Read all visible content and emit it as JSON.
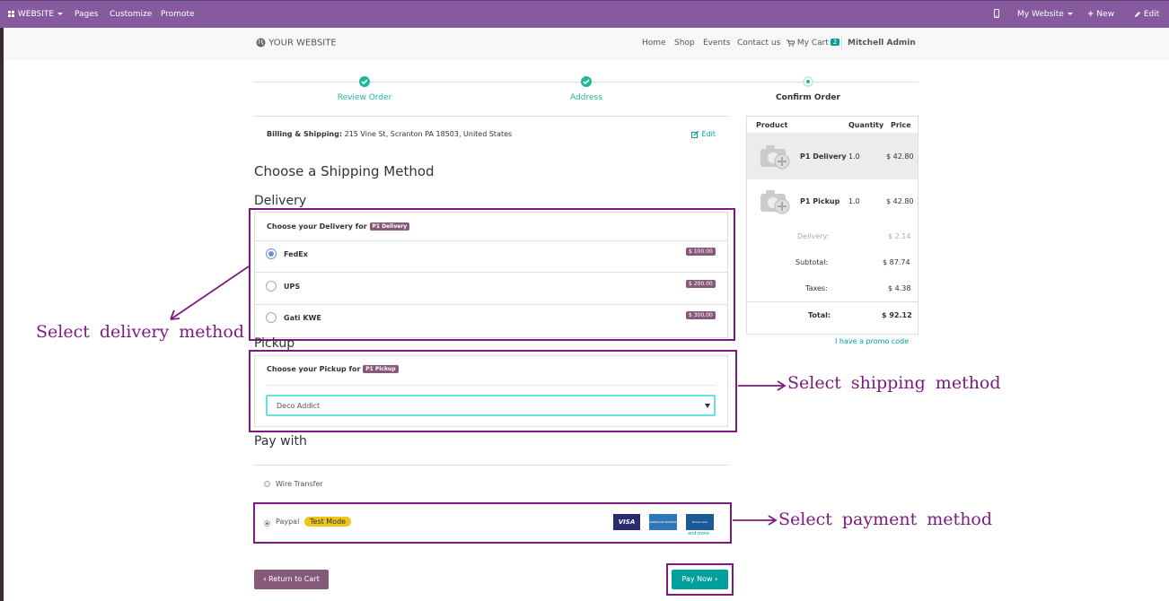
{
  "adminbar": {
    "website": "WEBSITE",
    "pages": "Pages",
    "customize": "Customize",
    "promote": "Promote",
    "my_website": "My Website",
    "new": "New",
    "edit": "Edit"
  },
  "navbar": {
    "logo": "YOUR WEBSITE",
    "links": [
      "Home",
      "Shop",
      "Events",
      "Contact us"
    ],
    "cart_label": "My Cart",
    "cart_count": "2",
    "user": "Mitchell Admin"
  },
  "wizard": {
    "steps": [
      {
        "label": "Review Order",
        "state": "done"
      },
      {
        "label": "Address",
        "state": "done"
      },
      {
        "label": "Confirm Order",
        "state": "current"
      }
    ]
  },
  "billing": {
    "label": "Billing & Shipping:",
    "address": "215 Vine St, Scranton PA 18503, United States",
    "edit": "Edit"
  },
  "shipping": {
    "title": "Choose a Shipping Method",
    "delivery_heading": "Delivery",
    "delivery_prompt": "Choose your Delivery for",
    "delivery_product": "P1 Delivery",
    "options": [
      {
        "name": "FedEx",
        "price": "$ 100.00",
        "selected": true
      },
      {
        "name": "UPS",
        "price": "$ 200.00",
        "selected": false
      },
      {
        "name": "Gati KWE",
        "price": "$ 300.00",
        "selected": false
      }
    ],
    "pickup_heading": "Pickup",
    "pickup_prompt": "Choose your Pickup for",
    "pickup_product": "P1 Pickup",
    "pickup_value": "Deco Addict"
  },
  "payment": {
    "title": "Pay with",
    "wire": "Wire Transfer",
    "paypal": "Paypal",
    "test_mode": "Test Mode",
    "cards": [
      "VISA",
      "AMERICAN EXPRESS",
      "Diners Club"
    ],
    "and_more": "and more"
  },
  "buttons": {
    "return": "Return to Cart",
    "pay": "Pay Now"
  },
  "cart": {
    "headers": [
      "Product",
      "Quantity",
      "Price"
    ],
    "rows": [
      {
        "name": "P1 Delivery",
        "qty": "1.0",
        "price": "$ 42.80"
      },
      {
        "name": "P1 Pickup",
        "qty": "1.0",
        "price": "$ 42.80"
      }
    ],
    "delivery_label": "Delivery:",
    "delivery_value": "$ 2.14",
    "subtotal_label": "Subtotal:",
    "subtotal_value": "$ 87.74",
    "taxes_label": "Taxes:",
    "taxes_value": "$ 4.38",
    "total_label": "Total:",
    "total_value": "$ 92.12",
    "promo": "I have a promo code"
  },
  "annotations": {
    "delivery": "Select delivery method",
    "shipping": "Select shipping method",
    "payment": "Select payment method"
  },
  "colors": {
    "adminbar": "#875a9f",
    "accent": "#00a09d",
    "annotation": "#7b1a7f",
    "tag": "#875a7b"
  }
}
